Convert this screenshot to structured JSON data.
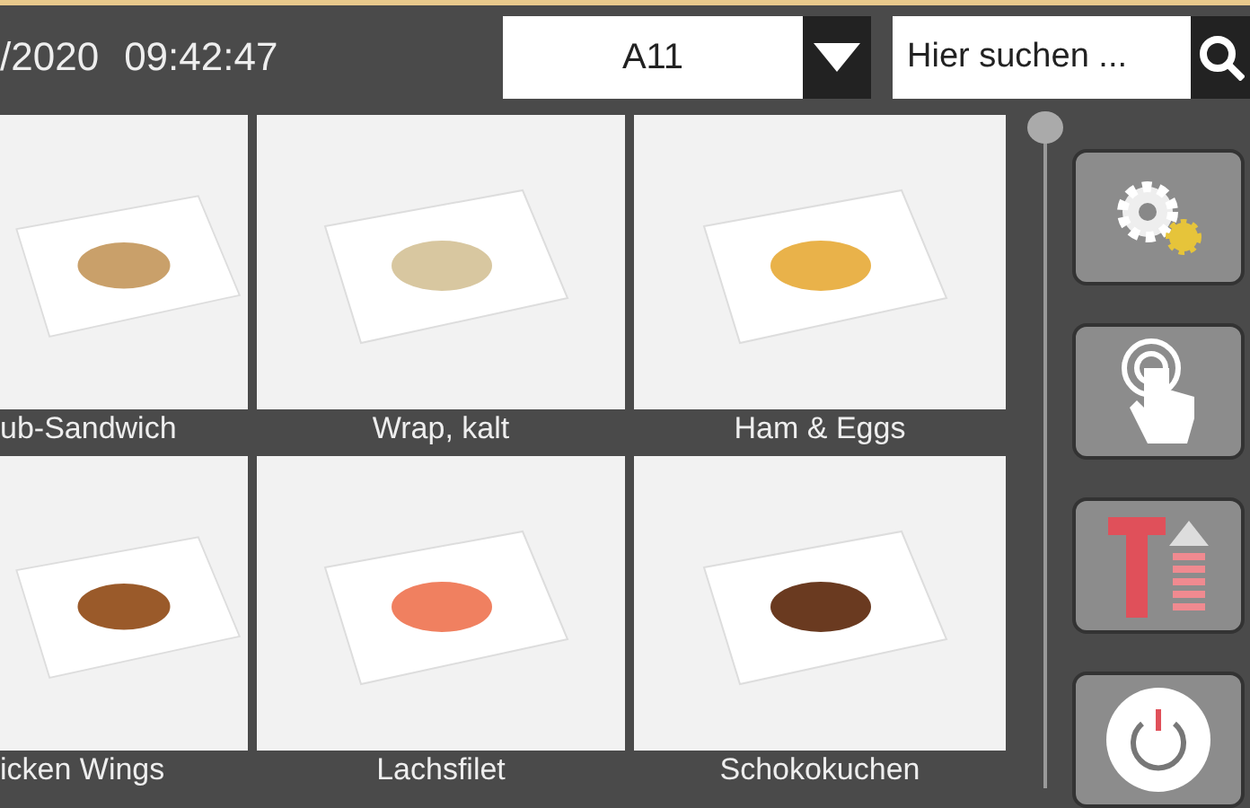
{
  "header": {
    "date": "/2020",
    "time": "09:42:47",
    "table_select": {
      "value": "A11"
    },
    "search": {
      "placeholder": "Hier suchen ..."
    }
  },
  "dishes": [
    {
      "name": "ub-Sandwich",
      "clipped": true
    },
    {
      "name": "Wrap, kalt",
      "clipped": false
    },
    {
      "name": "Ham & Eggs",
      "clipped": false
    },
    {
      "name": "icken Wings",
      "clipped": true
    },
    {
      "name": "Lachsfilet",
      "clipped": false
    },
    {
      "name": "Schokokuchen",
      "clipped": false
    }
  ],
  "side_buttons": [
    {
      "kind": "settings"
    },
    {
      "kind": "touch"
    },
    {
      "kind": "text-size"
    },
    {
      "kind": "power"
    }
  ]
}
